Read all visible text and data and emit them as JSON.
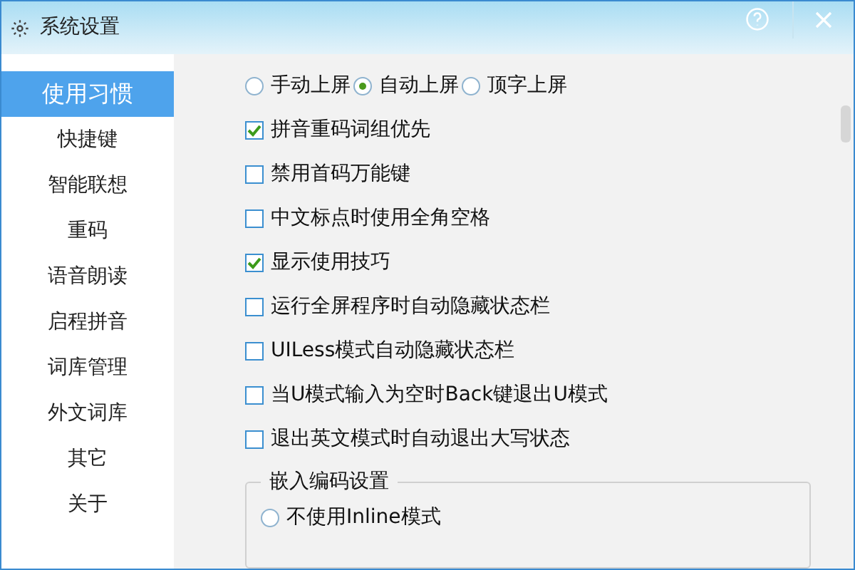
{
  "window": {
    "title": "系统设置"
  },
  "sidebar": {
    "items": [
      {
        "label": "使用习惯",
        "selected": true
      },
      {
        "label": "快捷键",
        "selected": false
      },
      {
        "label": "智能联想",
        "selected": false
      },
      {
        "label": "重码",
        "selected": false
      },
      {
        "label": "语音朗读",
        "selected": false
      },
      {
        "label": "启程拼音",
        "selected": false
      },
      {
        "label": "词库管理",
        "selected": false
      },
      {
        "label": "外文词库",
        "selected": false
      },
      {
        "label": "其它",
        "selected": false
      },
      {
        "label": "关于",
        "selected": false
      }
    ]
  },
  "commit_mode": [
    {
      "label": "手动上屏",
      "selected": false
    },
    {
      "label": "自动上屏",
      "selected": true
    },
    {
      "label": "顶字上屏",
      "selected": false
    }
  ],
  "options": [
    {
      "label": "拼音重码词组优先",
      "checked": true
    },
    {
      "label": "禁用首码万能键",
      "checked": false
    },
    {
      "label": "中文标点时使用全角空格",
      "checked": false
    },
    {
      "label": "显示使用技巧",
      "checked": true
    },
    {
      "label": "运行全屏程序时自动隐藏状态栏",
      "checked": false
    },
    {
      "label": "UILess模式自动隐藏状态栏",
      "checked": false
    },
    {
      "label": "当U模式输入为空时Back键退出U模式",
      "checked": false
    },
    {
      "label": "退出英文模式时自动退出大写状态",
      "checked": false
    }
  ],
  "inline_group": {
    "title": "嵌入编码设置",
    "options": [
      {
        "label": "不使用Inline模式",
        "selected": false
      }
    ]
  }
}
